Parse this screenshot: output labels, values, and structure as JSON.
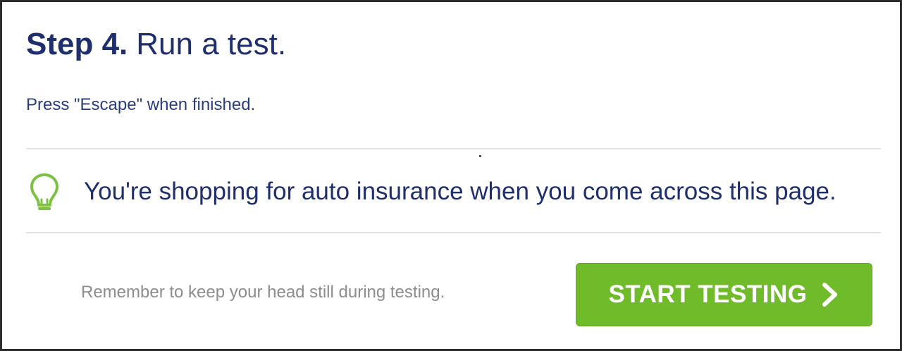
{
  "header": {
    "step_label": "Step 4.",
    "title_text": "Run a test.",
    "instruction": "Press \"Escape\" when finished."
  },
  "scenario": {
    "icon": "lightbulb-icon",
    "text": "You're shopping for auto insurance when you come across this page."
  },
  "footer": {
    "reminder": "Remember to keep your head still during testing.",
    "start_button_label": "START TESTING",
    "start_button_icon": "chevron-right-icon"
  },
  "colors": {
    "title": "#1f2f6e",
    "accent_green": "#6fbb2a",
    "icon_green": "#7cc242",
    "muted_text": "#8d8d8d",
    "divider": "#e3e3e3"
  }
}
